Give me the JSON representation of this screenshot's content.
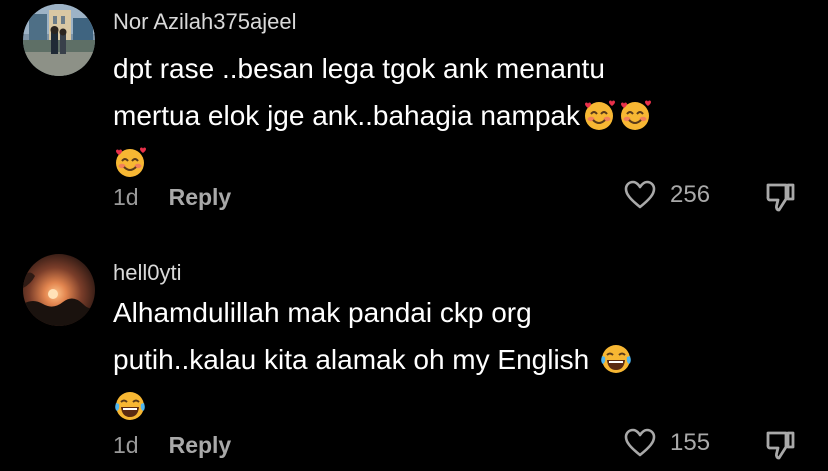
{
  "comments": [
    {
      "username": "Nor Azilah375ajeel",
      "avatar_icon": "profile-photo-building",
      "text_line1": "dpt rase ..besan lega tgok ank menantu",
      "text_line2": "mertua elok jge ank..bahagia nampak",
      "emoji": "smiling-face-with-hearts",
      "time": "1d",
      "reply_label": "Reply",
      "like_count": "256"
    },
    {
      "username": "hell0yti",
      "avatar_icon": "profile-photo-sunset",
      "text_line1": "Alhamdulillah mak pandai ckp org",
      "text_line2": "putih..kalau kita alamak oh my English",
      "emoji": "face-with-tears-of-joy",
      "time": "1d",
      "reply_label": "Reply",
      "like_count": "155"
    }
  ],
  "colors": {
    "background": "#000000",
    "username": "#d9d9d9",
    "text": "#ffffff",
    "meta": "#9a9a9a"
  }
}
